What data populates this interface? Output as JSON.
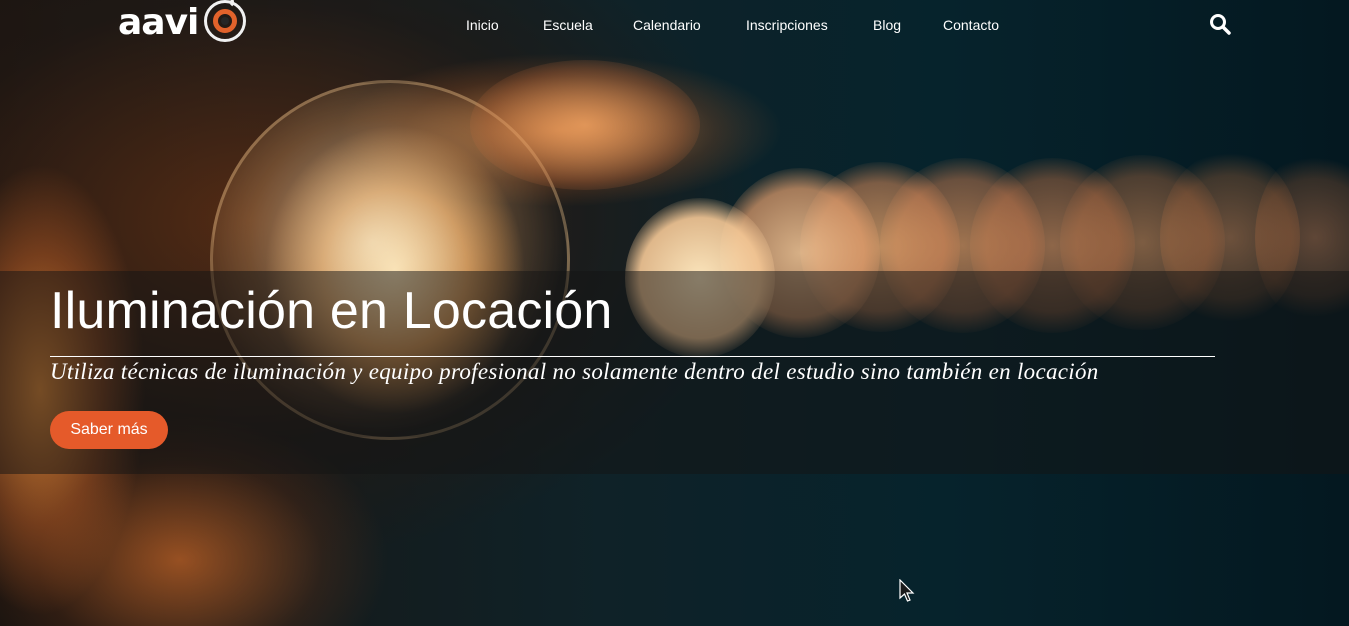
{
  "brand": {
    "logo_text": "aavi",
    "accent_color": "#e55a2a"
  },
  "nav": {
    "items": [
      {
        "label": "Inicio"
      },
      {
        "label": "Escuela"
      },
      {
        "label": "Calendario"
      },
      {
        "label": "Inscripciones"
      },
      {
        "label": "Blog"
      },
      {
        "label": "Contacto"
      }
    ],
    "search_icon": "search-icon"
  },
  "hero": {
    "title": "Iluminación en Locación",
    "subtitle": "Utiliza técnicas de iluminación y equipo profesional no solamente dentro del estudio sino también en locación",
    "cta_label": "Saber más",
    "background": "bokeh-light-bulbs-photo"
  }
}
